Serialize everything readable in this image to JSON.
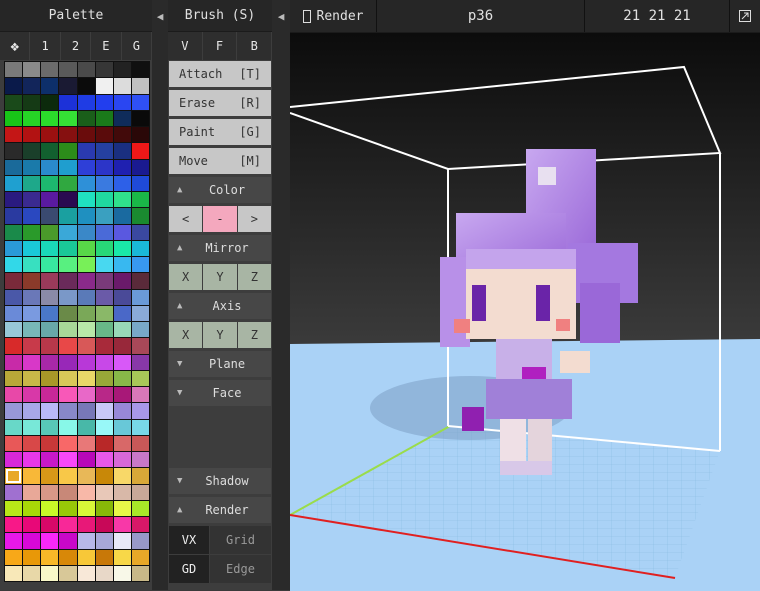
{
  "palette": {
    "title": "Palette",
    "tabs": [
      "1",
      "2",
      "E",
      "G"
    ],
    "move_icon": "four-diamonds-icon",
    "colors": [
      "#7a7a7a",
      "#8a8a8a",
      "#6b6b6b",
      "#5a5a5a",
      "#4a4a4a",
      "#363636",
      "#222222",
      "#101010",
      "#0a1a4a",
      "#12255a",
      "#0d2f6a",
      "#1a1a33",
      "#0b0b0b",
      "#f0f0f0",
      "#dcdcdc",
      "#c0c0c0",
      "#1a4a1a",
      "#153a15",
      "#0c2a0c",
      "#1c31d8",
      "#1f3ce4",
      "#223eee",
      "#2a46f2",
      "#2f50f5",
      "#18c418",
      "#26d426",
      "#2bdc2b",
      "#35e035",
      "#1a5e1a",
      "#1a7a1a",
      "#0f2c5a",
      "#0a0a0a",
      "#c41616",
      "#b21212",
      "#9c1010",
      "#861010",
      "#6a0c0c",
      "#5a0b0b",
      "#420a0a",
      "#2a0808",
      "#2a2a2a",
      "#1a3f2a",
      "#12602f",
      "#2c8c1a",
      "#2a3ab0",
      "#2540a0",
      "#1a2f80",
      "#ee1818",
      "#1a6a9a",
      "#1a7aaa",
      "#2a8acc",
      "#1f9ecf",
      "#2e3fd8",
      "#2c35c8",
      "#1f20b0",
      "#1a1a90",
      "#1fa0d0",
      "#1ea88a",
      "#1db86f",
      "#30a840",
      "#2e90d8",
      "#3a7ae0",
      "#2d60e8",
      "#1f4ad8",
      "#2a1a80",
      "#3a2a90",
      "#5a1aa0",
      "#2a0a50",
      "#20e0c0",
      "#20d8a0",
      "#30e08c",
      "#1ab848",
      "#2a3aa0",
      "#2a48c0",
      "#3a4a70",
      "#1aa0a0",
      "#1f90c0",
      "#3aa0c0",
      "#1a6aa0",
      "#1a8a30",
      "#1a8a4a",
      "#2a9a2a",
      "#4a9a2a",
      "#3aa8d8",
      "#3a88c8",
      "#4a6ad8",
      "#5a58e0",
      "#3a48a0",
      "#2a9ad8",
      "#1ac8d8",
      "#1ad8b8",
      "#1ac898",
      "#58d848",
      "#28d878",
      "#1ae8a8",
      "#1ab8d8",
      "#32d8e8",
      "#38e0c0",
      "#38e8a0",
      "#58f080",
      "#78f058",
      "#48d8f0",
      "#38b8f0",
      "#3898f0",
      "#7a2a3a",
      "#8a3a2a",
      "#9a3a5a",
      "#6a2a5a",
      "#8a2a8a",
      "#7a3a7a",
      "#6a1a6a",
      "#5a2a3a",
      "#4a58a8",
      "#6a78b8",
      "#8a8aa8",
      "#7a98c8",
      "#5a7ab8",
      "#6a5aa8",
      "#4a4a98",
      "#6a9ad8",
      "#6a8ad8",
      "#7a9ae0",
      "#4a78c8",
      "#6a8a48",
      "#7aa858",
      "#8ab868",
      "#4a68c8",
      "#8aaad8",
      "#98c8d8",
      "#78b8b8",
      "#68a8a8",
      "#a8d898",
      "#b8e8a8",
      "#68b888",
      "#98d8b8",
      "#78a8c8",
      "#d82a2a",
      "#c83a4a",
      "#b8384a",
      "#e84848",
      "#d85858",
      "#a82a3a",
      "#98283a",
      "#a84858",
      "#c82aa8",
      "#d838c8",
      "#a828a8",
      "#9828b8",
      "#b838d8",
      "#c848e8",
      "#d858f8",
      "#8838a8",
      "#b8a838",
      "#c8b848",
      "#a89828",
      "#d8c858",
      "#e8d868",
      "#98a838",
      "#88b848",
      "#a8c858",
      "#e848a8",
      "#d838a8",
      "#c82898",
      "#f858b8",
      "#e868c8",
      "#b82888",
      "#a81878",
      "#d878b8",
      "#9898d8",
      "#a8a8e8",
      "#b8b8f8",
      "#8888c8",
      "#7878b8",
      "#c8c8f8",
      "#9888d8",
      "#a898e8",
      "#68d8c8",
      "#78e8d8",
      "#58c8b8",
      "#88f8e8",
      "#48b8a8",
      "#98f8f8",
      "#68c8d8",
      "#78d8e8",
      "#e85858",
      "#d84848",
      "#c83838",
      "#f86868",
      "#e87878",
      "#b82828",
      "#d86868",
      "#c85858",
      "#d828d8",
      "#e838e8",
      "#c818c8",
      "#f848f8",
      "#b808b8",
      "#e858e8",
      "#d868d8",
      "#c878c8",
      "#e8a828",
      "#f8b838",
      "#d89818",
      "#f8c848",
      "#e8b858",
      "#c88808",
      "#f8d868",
      "#d8a838",
      "#a070d0",
      "#e8a898",
      "#d89888",
      "#c88878",
      "#f8b8a8",
      "#e8c8b8",
      "#d8b8a8",
      "#c8a898",
      "#b8e818",
      "#a8d808",
      "#c8f828",
      "#98c808",
      "#d8f838",
      "#88b808",
      "#e8f848",
      "#a8e828",
      "#f81888",
      "#e80878",
      "#d80868",
      "#f82898",
      "#e81878",
      "#c80858",
      "#f838a8",
      "#d81868",
      "#e818e8",
      "#d808d8",
      "#f828f8",
      "#c808c8",
      "#b8b8e8",
      "#a8a8d8",
      "#e8e8f8",
      "#9898c8",
      "#f8a818",
      "#e89808",
      "#f8b828",
      "#d88808",
      "#f8c838",
      "#c87808",
      "#f8d848",
      "#e8a828",
      "#f8e8b8",
      "#e8d8a8",
      "#f8f8c8",
      "#d8c898",
      "#f8e8d8",
      "#e8d8c8",
      "#f8f8e8",
      "#c8b888"
    ],
    "selected_index": 200
  },
  "brush": {
    "title": "Brush (S)",
    "modes": [
      "V",
      "F",
      "B"
    ],
    "tools": [
      {
        "label": "Attach",
        "key": "[T]"
      },
      {
        "label": "Erase",
        "key": "[R]"
      },
      {
        "label": "Paint",
        "key": "[G]"
      },
      {
        "label": "Move",
        "key": "[M]"
      }
    ],
    "color_section": "Color",
    "color_prev": "<",
    "color_value": "-",
    "color_next": ">",
    "swatch_color": "#f4a8be",
    "mirror_section": "Mirror",
    "mirror_axes": [
      "X",
      "Y",
      "Z"
    ],
    "axis_section": "Axis",
    "axis_axes": [
      "X",
      "Y",
      "Z"
    ],
    "plane_section": "Plane",
    "face_section": "Face",
    "shadow_section": "Shadow",
    "render_section": "Render",
    "vx_label": "VX",
    "grid_label": "Grid",
    "gd_label": "GD",
    "edge_label": "Edge"
  },
  "viewport": {
    "render_label": "Render",
    "model_name": "p36",
    "size": "21 21 21",
    "maximize_icon": "maximize-icon"
  }
}
